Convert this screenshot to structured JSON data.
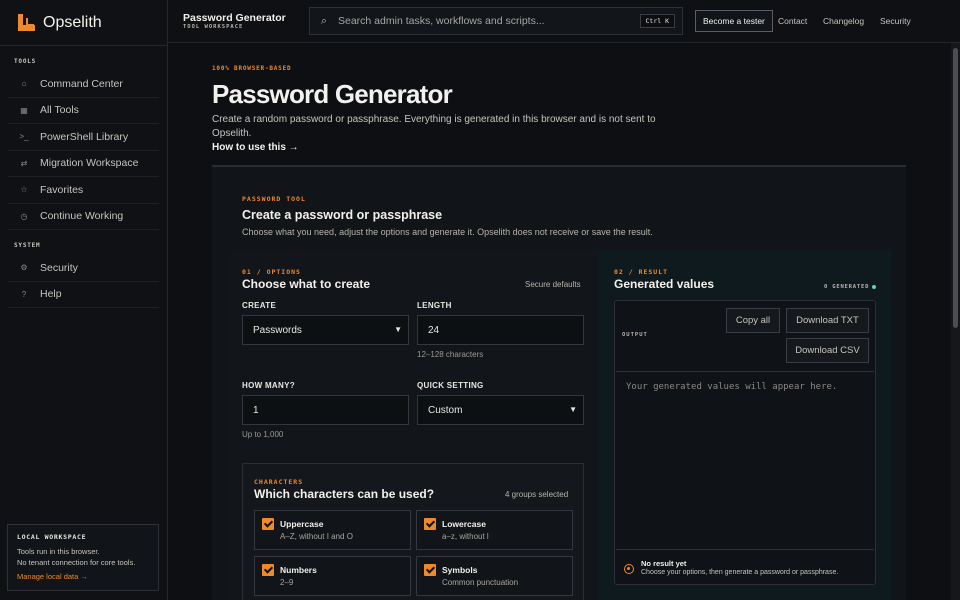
{
  "brand": {
    "name": "Opselith",
    "accent": "#f0892a"
  },
  "sidebar": {
    "tools_title": "TOOLS",
    "tools": [
      {
        "label": "Command Center",
        "icon": "home-icon"
      },
      {
        "label": "All Tools",
        "icon": "grid-icon"
      },
      {
        "label": "PowerShell Library",
        "icon": "terminal-icon"
      },
      {
        "label": "Migration Workspace",
        "icon": "swap-icon"
      },
      {
        "label": "Favorites",
        "icon": "star-icon"
      },
      {
        "label": "Continue Working",
        "icon": "clock-icon"
      }
    ],
    "system_title": "SYSTEM",
    "system": [
      {
        "label": "Security",
        "icon": "gear-icon"
      },
      {
        "label": "Help",
        "icon": "question-icon"
      }
    ],
    "local": {
      "title": "LOCAL WORKSPACE",
      "line1": "Tools run in this browser.",
      "line2": "No tenant connection for core tools.",
      "link": "Manage local data →"
    }
  },
  "topbar": {
    "title": "Password Generator",
    "subtitle": "TOOL WORKSPACE",
    "search_placeholder": "Search admin tasks, workflows and scripts...",
    "shortcut": "Ctrl K",
    "tester": "Become a tester",
    "links": [
      "Contact",
      "Changelog",
      "Security"
    ]
  },
  "page": {
    "eyebrow": "100% BROWSER-BASED",
    "title": "Password Generator",
    "intro": "Create a random password or passphrase. Everything is generated in this browser and is not sent to Opselith.",
    "howto": "How to use this →"
  },
  "panel": {
    "eyebrow": "PASSWORD TOOL",
    "title": "Create a password or passphrase",
    "desc": "Choose what you need, adjust the options and generate it. Opselith does not receive or save the result."
  },
  "options": {
    "step": "01 / OPTIONS",
    "title": "Choose what to create",
    "defaults": "Secure defaults",
    "create_label": "CREATE",
    "create_value": "Passwords",
    "length_label": "LENGTH",
    "length_value": "24",
    "length_hint": "12–128 characters",
    "howmany_label": "HOW MANY?",
    "howmany_value": "1",
    "howmany_hint": "Up to 1,000",
    "quick_label": "QUICK SETTING",
    "quick_value": "Custom",
    "chars": {
      "eyebrow": "CHARACTERS",
      "title": "Which characters can be used?",
      "count": "4 groups selected",
      "groups": [
        {
          "title": "Uppercase",
          "sub": "A–Z, without I and O"
        },
        {
          "title": "Lowercase",
          "sub": "a–z, without l"
        },
        {
          "title": "Numbers",
          "sub": "2–9"
        },
        {
          "title": "Symbols",
          "sub": "Common punctuation"
        }
      ]
    }
  },
  "result": {
    "step": "02 / RESULT",
    "title": "Generated values",
    "generated": "0 GENERATED",
    "output_label": "OUTPUT",
    "copy": "Copy all",
    "txt": "Download TXT",
    "csv": "Download CSV",
    "placeholder": "Your generated values will appear here.",
    "empty_title": "No result yet",
    "empty_sub": "Choose your options, then generate a password or passphrase."
  }
}
